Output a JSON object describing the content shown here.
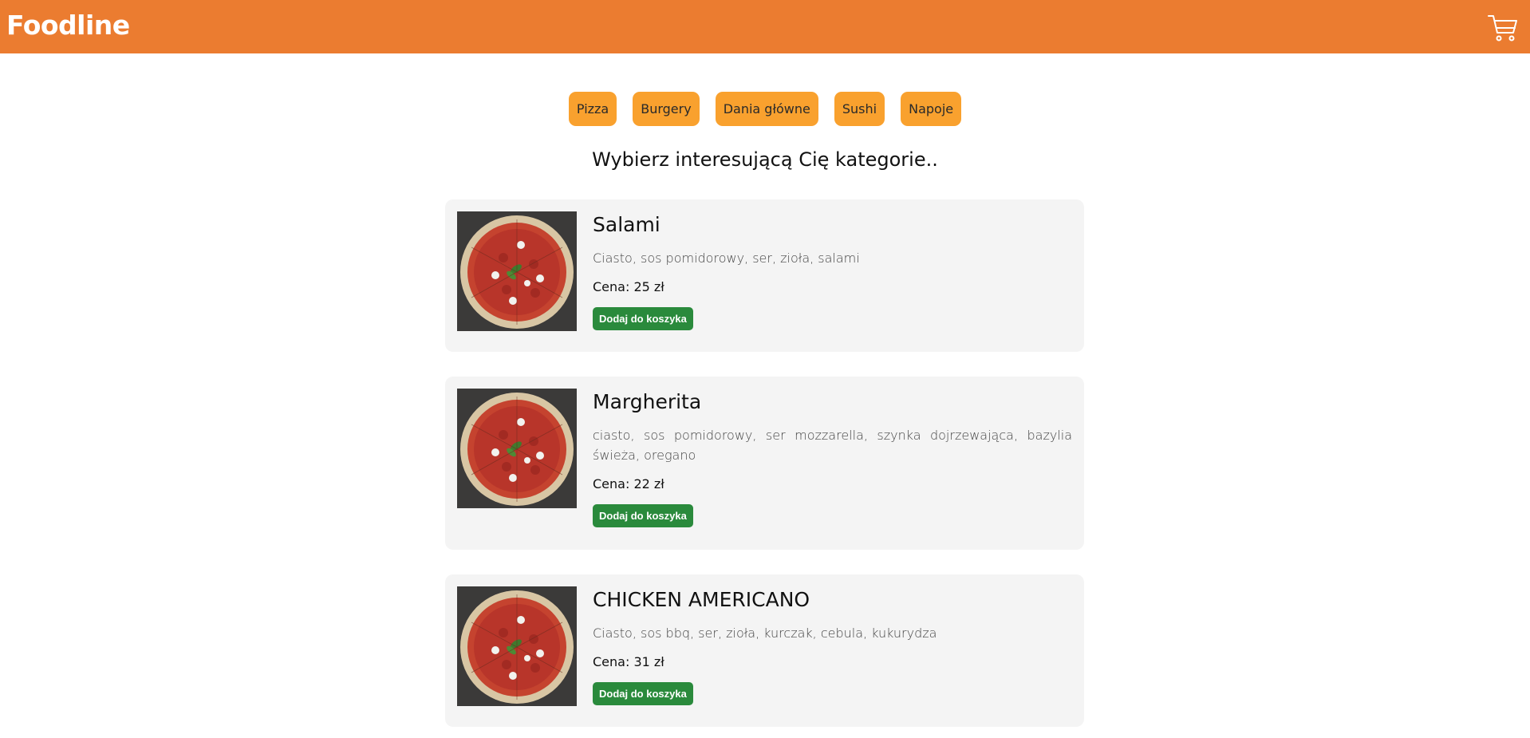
{
  "header": {
    "brand": "Foodline",
    "cart_icon": "shopping-cart-icon"
  },
  "categories": [
    {
      "label": "Pizza"
    },
    {
      "label": "Burgery"
    },
    {
      "label": "Dania główne"
    },
    {
      "label": "Sushi"
    },
    {
      "label": "Napoje"
    }
  ],
  "heading": "Wybierz interesującą Cię kategorie..",
  "products": [
    {
      "name": "Salami",
      "description": "Ciasto, sos pomidorowy, ser, zioła, salami",
      "price": "Cena: 25 zł",
      "button": "Dodaj do koszyka"
    },
    {
      "name": "Margherita",
      "description": "ciasto, sos pomidorowy, ser mozzarella, szynka dojrzewająca, bazylia świeża, oregano",
      "price": "Cena: 22 zł",
      "button": "Dodaj do koszyka"
    },
    {
      "name": "CHICKEN AMERICANO",
      "description": "Ciasto, sos bbq, ser, zioła, kurczak, cebula, kukurydza",
      "price": "Cena: 31 zł",
      "button": "Dodaj do koszyka"
    }
  ],
  "colors": {
    "header": "#eb7c30",
    "category_button": "#f9a12e",
    "card_background": "#f4f4f4",
    "add_button": "#2a8a3c"
  }
}
